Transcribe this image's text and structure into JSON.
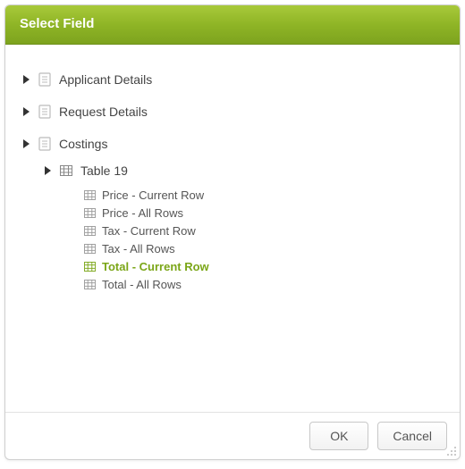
{
  "dialog": {
    "title": "Select Field"
  },
  "tree": {
    "applicant_details": {
      "label": "Applicant Details"
    },
    "request_details": {
      "label": "Request Details"
    },
    "costings": {
      "label": "Costings",
      "table19": {
        "label": "Table 19",
        "items": [
          {
            "label": "Price - Current Row"
          },
          {
            "label": "Price - All Rows"
          },
          {
            "label": "Tax - Current Row"
          },
          {
            "label": "Tax - All Rows"
          },
          {
            "label": "Total - Current Row"
          },
          {
            "label": "Total - All Rows"
          }
        ]
      }
    }
  },
  "buttons": {
    "ok": "OK",
    "cancel": "Cancel"
  },
  "colors": {
    "accent": "#8fb526",
    "selected": "#7ba618"
  }
}
